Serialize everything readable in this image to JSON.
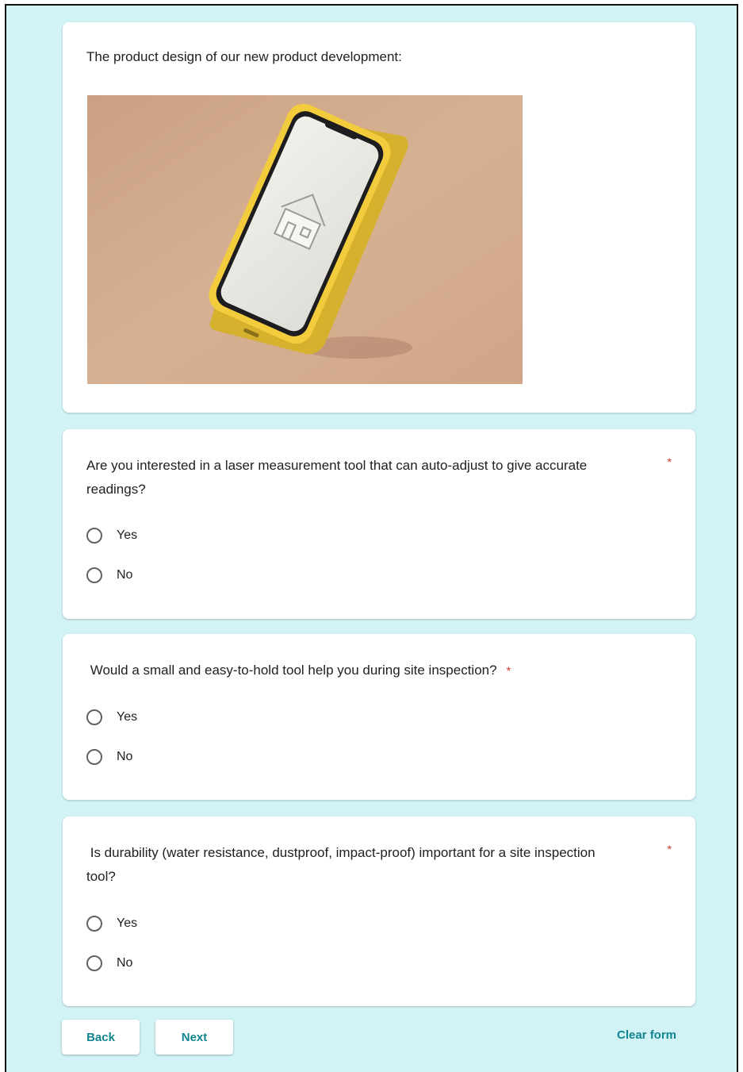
{
  "intro": {
    "text": "The product design of our new product development:"
  },
  "questions": [
    {
      "text": "Are you interested in a laser measurement tool that can auto-adjust to give accurate readings?",
      "required_mark": "*",
      "options": [
        "Yes",
        "No"
      ]
    },
    {
      "text": " Would a small and easy-to-hold tool help you during site inspection?",
      "required_mark": "*",
      "options": [
        "Yes",
        "No"
      ]
    },
    {
      "text": " Is durability (water resistance, dustproof, impact-proof) important for a site inspection tool?",
      "required_mark": "*",
      "options": [
        "Yes",
        "No"
      ]
    }
  ],
  "nav": {
    "back_label": "Back",
    "next_label": "Next",
    "clear_label": "Clear form"
  },
  "colors": {
    "page_background": "#d2f3f6",
    "accent": "#12858f",
    "required": "#d93025"
  }
}
